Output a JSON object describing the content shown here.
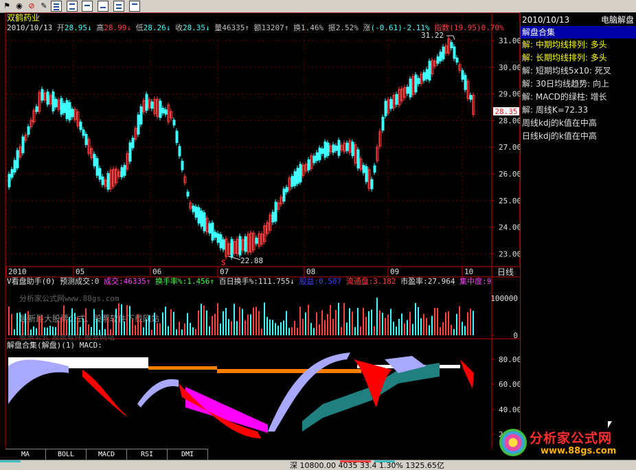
{
  "toolbar": {
    "icons": [
      "stock-flag-icon",
      "search-globe-icon",
      "cancel-icon",
      "draw-pen-icon",
      "list-view-icon",
      "layout-view-icon",
      "image-view-icon",
      "chart-view-icon",
      "text-view-icon",
      "window-view-icon"
    ]
  },
  "main": {
    "stock_name": "双鹤药业",
    "info_line": {
      "date": "2010/10/13",
      "items": [
        {
          "label": "开",
          "value": "28.95",
          "arrow": "↓",
          "label_color": "#c0c0c0",
          "value_color": "#40ffff"
        },
        {
          "label": "高",
          "value": "28.99",
          "arrow": "↓",
          "label_color": "#c0c0c0",
          "value_color": "#ff4040"
        },
        {
          "label": "低",
          "value": "28.26",
          "arrow": "↓",
          "label_color": "#c0c0c0",
          "value_color": "#40ffff"
        },
        {
          "label": "收",
          "value": "28.35",
          "arrow": "↓",
          "label_color": "#c0c0c0",
          "value_color": "#40ffff"
        },
        {
          "label": "量",
          "value": "46335",
          "arrow": "↑",
          "label_color": "#c0c0c0",
          "value_color": "#c0c0c0"
        },
        {
          "label": "额",
          "value": "13207",
          "arrow": "↑",
          "label_color": "#c0c0c0",
          "value_color": "#c0c0c0"
        },
        {
          "label": "换",
          "value": "1.46%",
          "arrow": "",
          "label_color": "#c0c0c0",
          "value_color": "#c0c0c0"
        },
        {
          "label": "振",
          "value": "2.52%",
          "arrow": "",
          "label_color": "#c0c0c0",
          "value_color": "#c0c0c0"
        },
        {
          "label": "涨",
          "value": "(-0.61)-2.11%",
          "arrow": "",
          "label_color": "#c0c0c0",
          "value_color": "#40ffff"
        },
        {
          "label": "指数",
          "value": "(19.95)0.70%",
          "arrow": "",
          "label_color": "#ff4040",
          "value_color": "#ff4040"
        }
      ]
    },
    "price_axis": [
      "31.00",
      "30.00",
      "29.00",
      "28.00",
      "27.00",
      "26.00",
      "25.00",
      "24.00",
      "23.00"
    ],
    "current_price": "28.35",
    "high_marker": "31.22",
    "low_marker": "22.88",
    "low_flag": "S",
    "date_axis": [
      "2010",
      "05",
      "06",
      "07",
      "08",
      "09",
      "10"
    ],
    "date_axis_label": "日线",
    "volume_panel": {
      "indicator_line": [
        {
          "text": "V看盘助手(0) 预测成交:0",
          "color": "#e0e0e0"
        },
        {
          "text": "成交:46335↑",
          "color": "#ff40ff"
        },
        {
          "text": "换手率%:1.456↑",
          "color": "#40ff40"
        },
        {
          "text": "百日换手%:111.755↓",
          "color": "#e0e0e0"
        },
        {
          "text": "股益:0.507",
          "color": "#4040ff"
        },
        {
          "text": "流通盘:3.182",
          "color": "#ff4040"
        },
        {
          "text": "市盈率:27.964",
          "color": "#e0e0e0"
        },
        {
          "text": "集中度:9",
          "color": "#ff40ff"
        }
      ],
      "axis": [
        "100000",
        "0"
      ],
      "watermark_1": "分析家公式网www.88gs.com",
      "watermark_2": "最新最大股票公式、股票软件下载网站",
      "watermark_3": "股票公式 股票软件 股票网站"
    },
    "macd_panel": {
      "title": "解盘合集(解盘)(1) MACD:",
      "axis": [
        "80.00",
        "60.00",
        "40.00",
        "20.00"
      ]
    },
    "tabs": [
      "MA",
      "BOLL",
      "MACD",
      "RSI",
      "DMI"
    ]
  },
  "right_panel": {
    "date": "2010/10/13",
    "brand": "电脑解盘",
    "title": "解盘合集",
    "rows": [
      {
        "text": "解: 中期均线排列: 多头",
        "color": "#ffff00"
      },
      {
        "text": "解: 长期均线排列: 多头",
        "color": "#ffff00"
      },
      {
        "text": "解: 短期均线5x10: 死叉",
        "color": "#e0e0e0"
      },
      {
        "text": "解: 30日均线趋势: 向上",
        "color": "#e0e0e0"
      },
      {
        "text": "解: MACD的绿柱: 增长",
        "color": "#e0e0e0"
      },
      {
        "text": "解: 周线K=72.33",
        "color": "#e0e0e0"
      },
      {
        "text": "周线kdj的k值在中高",
        "color": "#e0e0e0"
      },
      {
        "text": "日线kdj的k值在中高",
        "color": "#e0e0e0"
      }
    ]
  },
  "status_bar": {
    "text": "深 10800.00 4035 33.4 1.30% 1325.65亿"
  },
  "logo": {
    "name": "分析家公式网",
    "url": "www.88gs.com"
  },
  "colors": {
    "up": "#ff4040",
    "down": "#40ffff",
    "grid": "#c00000",
    "bg": "#000000"
  }
}
